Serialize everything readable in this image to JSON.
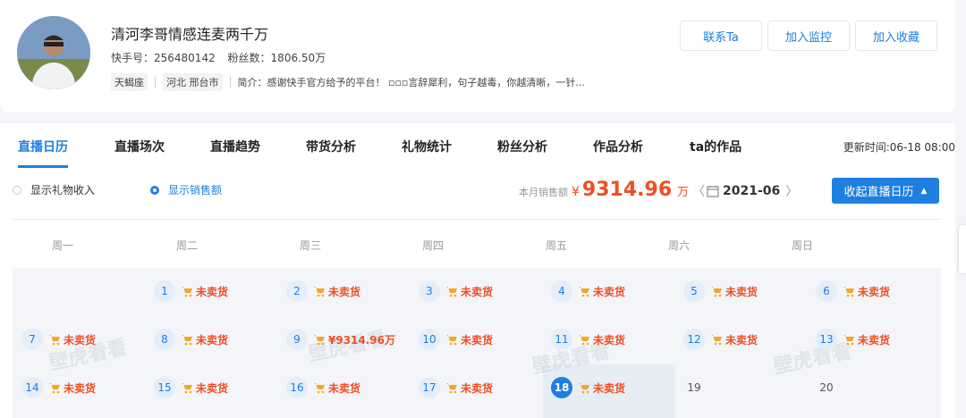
{
  "profile": {
    "name": "清河李哥情感连麦两千万",
    "kuaishou_id_label": "快手号：256480142",
    "fans_label": "粉丝数：1806.50万",
    "zodiac": "天蝎座",
    "location": "河北 邢台市",
    "intro": "简介：感谢快手官方给予的平台！ ▫▫▫言辞犀利，句子越毒，你越清晰，一针..."
  },
  "actions": {
    "contact": "联系Ta",
    "monitor": "加入监控",
    "favorite": "加入收藏"
  },
  "tabs": [
    "直播日历",
    "直播场次",
    "直播趋势",
    "带货分析",
    "礼物统计",
    "粉丝分析",
    "作品分析",
    "ta的作品"
  ],
  "updated_at": "更新时间:06-18 08:00",
  "toggles": {
    "gift_income": "显示礼物收入",
    "sales": "显示销售额",
    "selected": "sales"
  },
  "summary": {
    "label": "本月销售额",
    "currency": "¥",
    "value": "9314.96",
    "unit": "万"
  },
  "month": {
    "value": "2021-06",
    "prev": "〈",
    "next": "〉"
  },
  "collapse_button": "收起直播日历",
  "weekdays": [
    "周一",
    "周二",
    "周三",
    "周四",
    "周五",
    "周六",
    "周日"
  ],
  "calendar": {
    "week1": [
      {
        "day": "1",
        "status": "未卖货"
      },
      {
        "day": "2",
        "status": "未卖货"
      },
      {
        "day": "3",
        "status": "未卖货"
      },
      {
        "day": "4",
        "status": "未卖货"
      },
      {
        "day": "5",
        "status": "未卖货"
      },
      {
        "day": "6",
        "status": "未卖货"
      }
    ],
    "week2": [
      {
        "day": "7",
        "status": "未卖货"
      },
      {
        "day": "8",
        "status": "未卖货"
      },
      {
        "day": "9",
        "status": "¥9314.96万"
      },
      {
        "day": "10",
        "status": "未卖货"
      },
      {
        "day": "11",
        "status": "未卖货"
      },
      {
        "day": "12",
        "status": "未卖货"
      },
      {
        "day": "13",
        "status": "未卖货"
      }
    ],
    "week3": [
      {
        "day": "14",
        "status": "未卖货"
      },
      {
        "day": "15",
        "status": "未卖货"
      },
      {
        "day": "16",
        "status": "未卖货"
      },
      {
        "day": "17",
        "status": "未卖货"
      },
      {
        "day": "18",
        "status": "未卖货"
      },
      {
        "day": "19",
        "status": ""
      },
      {
        "day": "20",
        "status": ""
      }
    ]
  },
  "watermark": "壁虎看看",
  "colors": {
    "accent": "#1e7fe0",
    "highlight": "#f04e23",
    "cart": "#f5a623"
  }
}
